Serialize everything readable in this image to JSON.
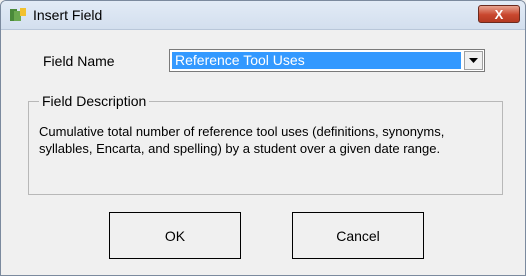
{
  "window": {
    "title": "Insert Field",
    "close_label": "X"
  },
  "form": {
    "field_name_label": "Field Name",
    "field_name_value": "Reference Tool Uses"
  },
  "description": {
    "legend": "Field Description",
    "text": "Cumulative total number of reference tool uses (definitions, synonyms, syllables, Encarta, and spelling) by a student over a given date range."
  },
  "buttons": {
    "ok_label": "OK",
    "cancel_label": "Cancel"
  },
  "colors": {
    "selection": "#3399ff",
    "close_button": "#c9472e",
    "titlebar": "#dbe5f1"
  },
  "icons": {
    "app": "window-app-icon",
    "dropdown": "chevron-down-icon",
    "close": "close-icon"
  }
}
